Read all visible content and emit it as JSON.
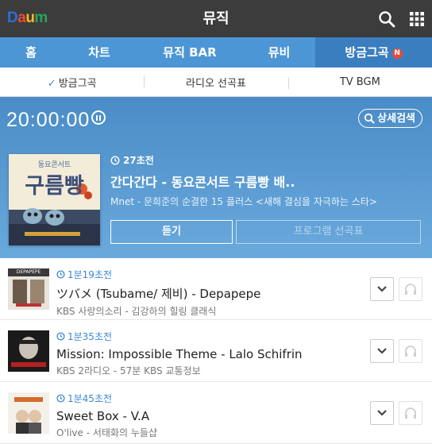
{
  "app": {
    "logo_letters": [
      "D",
      "a",
      "u",
      "m"
    ],
    "logo_colors": [
      "#2b6edf",
      "#e94b35",
      "#f7b81a",
      "#26a65b"
    ],
    "title": "뮤직"
  },
  "tabs": [
    {
      "label": "홈"
    },
    {
      "label": "차트"
    },
    {
      "label": "뮤직 BAR"
    },
    {
      "label": "뮤비"
    },
    {
      "label": "방금그곡",
      "badge": "N",
      "active": true
    }
  ],
  "subtabs": [
    {
      "label": "방금그곡",
      "active": true
    },
    {
      "label": "라디오 선곡표"
    },
    {
      "label": "TV BGM"
    }
  ],
  "hero": {
    "clock": "20:00:00",
    "detail_search_label": "상세검색",
    "now": {
      "ago": "27초전",
      "title": "간다간다 - 동요콘서트 구름빵 배..",
      "subtitle": "Mnet - 문희준의 순결한 15 플러스 <새해 결심을 자극하는 스타>",
      "album_caption": "동요콘서트",
      "album_title": "구름빵"
    },
    "listen_label": "듣기",
    "program_label": "프로그램 선곡표"
  },
  "tracks": [
    {
      "ago": "1분19초전",
      "title": "ツバメ (Tsubame/ 제비) - Depapepe",
      "subtitle": "KBS 사랑의소리 - 김강하의 힐링 클래식",
      "thumb_text": "DEPAPEPE"
    },
    {
      "ago": "1분35초전",
      "title": "Mission: Impossible Theme - Lalo Schifrin",
      "subtitle": "KBS 2라디오 - 57분 KBS 교통정보",
      "thumb_text": ""
    },
    {
      "ago": "1분45초전",
      "title": "Sweet Box - V.A",
      "subtitle": "O'live - 서태화의 누들샵",
      "thumb_text": ""
    }
  ],
  "colors": {
    "topbar": "#3c3c3c",
    "tabs": "#4c96d5",
    "tab_active": "#3a7ec0",
    "hero": "#5a9bd3",
    "accent": "#3a87d6",
    "badge": "#e74c3c"
  }
}
